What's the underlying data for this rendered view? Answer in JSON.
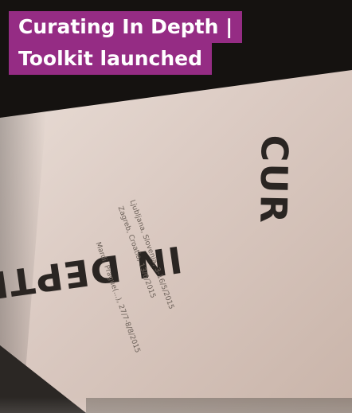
{
  "headline": {
    "line_1": "Curating In Depth |",
    "line_2": "Toolkit launched"
  },
  "photo": {
    "subject": "Photo of a printed toolkit cover",
    "cover_top_word": "CUR",
    "cover_main_word": "IN DEPTH",
    "venues": [
      "Ljubljana, Slovenia, 3-16/5/2015",
      "Zagreb, Croatia, 13/6/2015",
      "Mardi, Prague(...), 27/7-8/8/2015"
    ]
  },
  "colors": {
    "title_background": "#952c84",
    "title_text": "#ffffff",
    "paper": "#d9c8bf",
    "background": "#1b1815"
  }
}
